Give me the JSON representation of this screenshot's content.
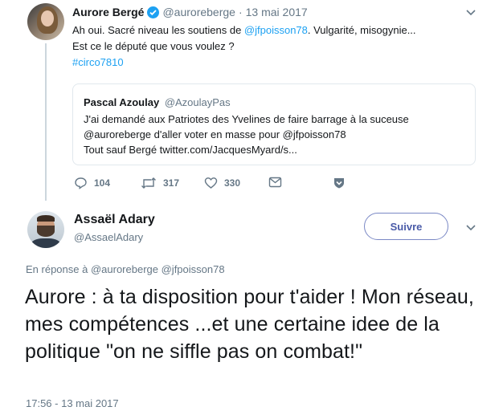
{
  "parent_tweet": {
    "author_name": "Aurore Bergé",
    "author_handle": "@auroreberge",
    "separator": "·",
    "date": "13 mai 2017",
    "text_line1_prefix": "Ah oui. Sacré niveau les soutiens de ",
    "text_line1_mention": "@jfpoisson78",
    "text_line1_suffix": ". Vulgarité, misogynie...",
    "text_line2": "Est ce le député que vous voulez ?",
    "hashtag": "#circo7810",
    "quoted": {
      "author_name": "Pascal Azoulay",
      "author_handle": "@AzoulayPas",
      "line1": "J'ai demandé aux Patriotes des Yvelines de faire barrage à la suceuse",
      "line2": "@auroreberge d'aller voter en masse pour @jfpoisson78",
      "line3": "Tout sauf Bergé twitter.com/JacquesMyard/s..."
    },
    "actions": {
      "replies": "104",
      "retweets": "317",
      "likes": "330"
    }
  },
  "focus_tweet": {
    "author_name": "Assaël Adary",
    "author_handle": "@AssaelAdary",
    "follow_label": "Suivre",
    "reply_prefix": "En réponse à",
    "reply_handles": "@auroreberge @jfpoisson78",
    "text": "Aurore : à ta disposition pour t'aider ! Mon réseau, mes compétences ...et une certaine idee de la politique \"on ne siffle pas on combat!\"",
    "timestamp": "17:56 - 13 mai 2017"
  },
  "colors": {
    "link": "#1da1f2",
    "muted": "#657786",
    "border": "#e1e8ed"
  }
}
